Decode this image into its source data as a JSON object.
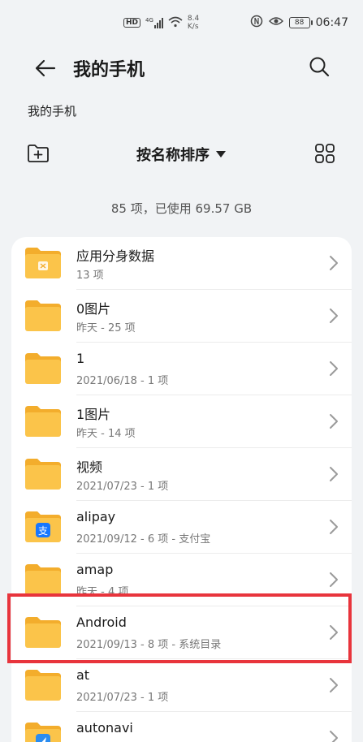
{
  "status_bar": {
    "net_type": "4G",
    "speed_value": "8.4",
    "speed_unit": "K/s",
    "battery": "88",
    "time": "06:47",
    "hd": "HD"
  },
  "header": {
    "title": "我的手机"
  },
  "breadcrumb": "我的手机",
  "toolbar": {
    "sort_label": "按名称排序"
  },
  "summary": "85 项，已使用 69.57 GB",
  "files": [
    {
      "name": "应用分身数据",
      "meta": "13 项",
      "icon": "app-clone-folder-icon"
    },
    {
      "name": "0图片",
      "meta": "昨天 - 25 项",
      "icon": "folder-icon"
    },
    {
      "name": "1",
      "meta": "2021/06/18 - 1 项",
      "icon": "folder-icon"
    },
    {
      "name": "1图片",
      "meta": "昨天 - 14 项",
      "icon": "folder-icon"
    },
    {
      "name": "视频",
      "meta": "2021/07/23 - 1 项",
      "icon": "folder-icon"
    },
    {
      "name": "alipay",
      "meta": "2021/09/12 - 6 项 - 支付宝",
      "icon": "alipay-folder-icon"
    },
    {
      "name": "amap",
      "meta": "昨天 - 4 项",
      "icon": "folder-icon"
    },
    {
      "name": "Android",
      "meta": "2021/09/13 - 8 项 - 系统目录",
      "icon": "folder-icon"
    },
    {
      "name": "at",
      "meta": "2021/07/23 - 1 项",
      "icon": "folder-icon"
    },
    {
      "name": "autonavi",
      "meta": "",
      "icon": "autonavi-folder-icon"
    }
  ],
  "colors": {
    "folder": "#fbc44a",
    "folder_back": "#f3ad2c",
    "highlight": "#e8343c",
    "alipay": "#1677ff"
  }
}
